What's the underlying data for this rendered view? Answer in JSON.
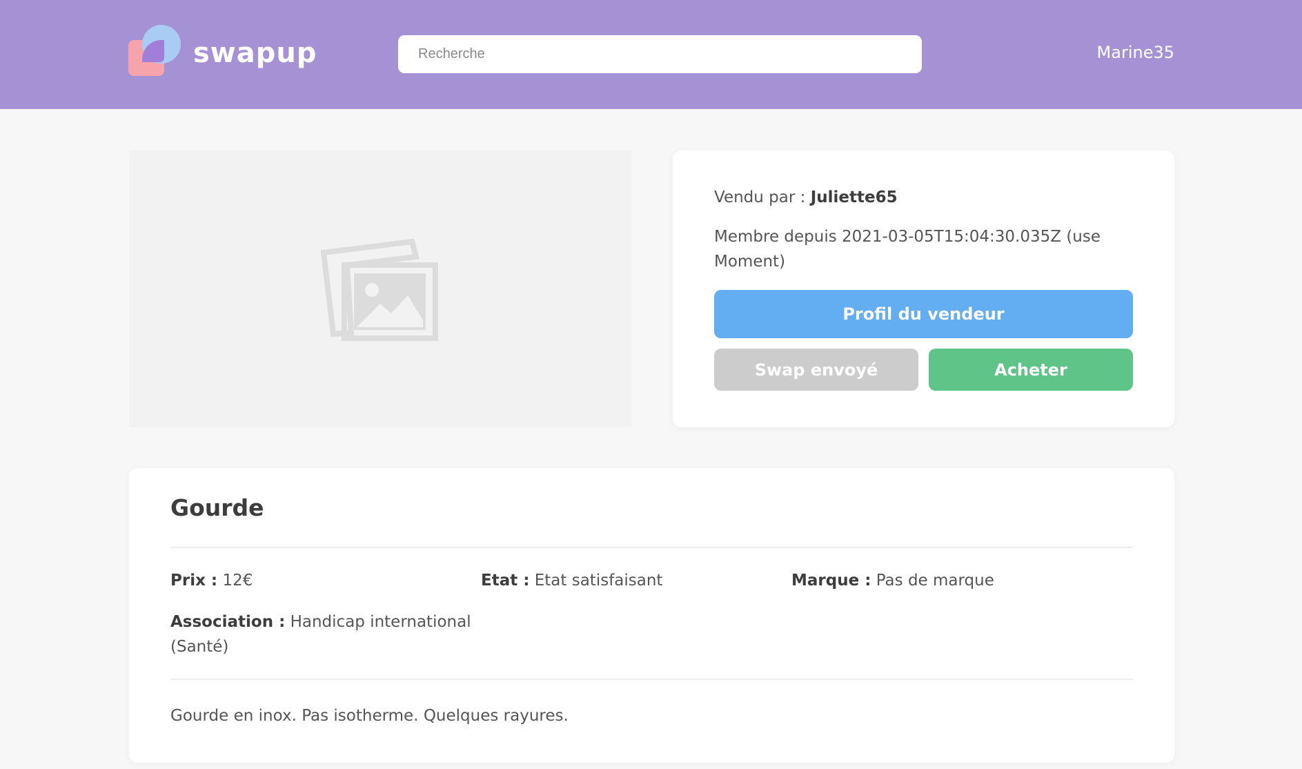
{
  "header": {
    "logo_text": "swapup",
    "search_placeholder": "Recherche",
    "username": "Marine35"
  },
  "image": {
    "icon": "image-placeholder-icon"
  },
  "seller": {
    "sold_by_label": "Vendu par :",
    "seller_name": "Juliette65",
    "member_since": "Membre depuis 2021-03-05T15:04:30.035Z (use Moment)",
    "profile_button": "Profil du vendeur",
    "swap_button": "Swap envoyé",
    "buy_button": "Acheter"
  },
  "product": {
    "title": "Gourde",
    "price_label": "Prix :",
    "price_value": "12€",
    "state_label": "Etat :",
    "state_value": "Etat satisfaisant",
    "brand_label": "Marque :",
    "brand_value": "Pas de marque",
    "association_label": "Association :",
    "association_value": "Handicap international (Santé)",
    "description": "Gourde en inox. Pas isotherme. Quelques rayures."
  },
  "colors": {
    "header_bg": "#a592d4",
    "profile_button": "#63aef3",
    "swap_button": "#cccccc",
    "buy_button": "#5ec488"
  }
}
